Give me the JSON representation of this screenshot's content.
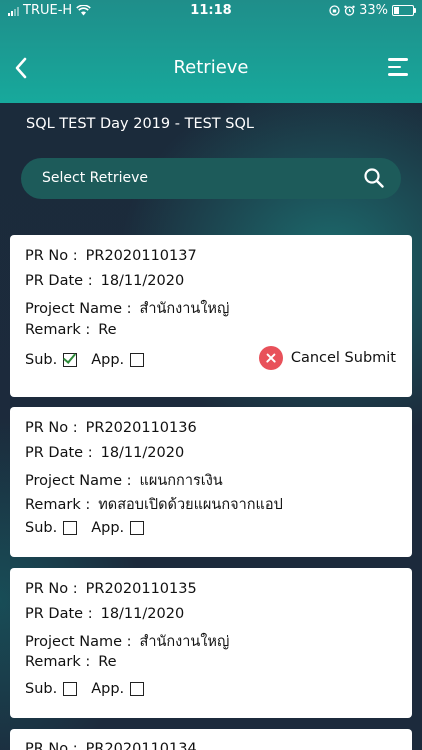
{
  "status_bar": {
    "carrier": "TRUE-H",
    "time": "11:18",
    "battery": "33%"
  },
  "header": {
    "title": "Retrieve"
  },
  "subtitle": "SQL TEST  Day 2019 - TEST SQL",
  "search": {
    "label": "Select Retrieve"
  },
  "labels": {
    "pr_no": "PR No :",
    "pr_date": "PR Date :",
    "project_name": "Project Name :",
    "remark": "Remark :",
    "sub": "Sub.",
    "app": "App."
  },
  "records": [
    {
      "pr_no": "PR2020110137",
      "pr_date": "18/11/2020",
      "project_name": "สำนักงานใหญ่",
      "remark": "Re",
      "sub_checked": true,
      "app_checked": false,
      "action": "Cancel Submit"
    },
    {
      "pr_no": "PR2020110136",
      "pr_date": "18/11/2020",
      "project_name": "แผนกการเงิน",
      "remark": "ทดสอบเปิดด้วยแผนกจากแอป",
      "sub_checked": false,
      "app_checked": false
    },
    {
      "pr_no": "PR2020110135",
      "pr_date": "18/11/2020",
      "project_name": "สำนักงานใหญ่",
      "remark": "Re",
      "sub_checked": false,
      "app_checked": false
    },
    {
      "pr_no": "PR2020110134"
    }
  ]
}
